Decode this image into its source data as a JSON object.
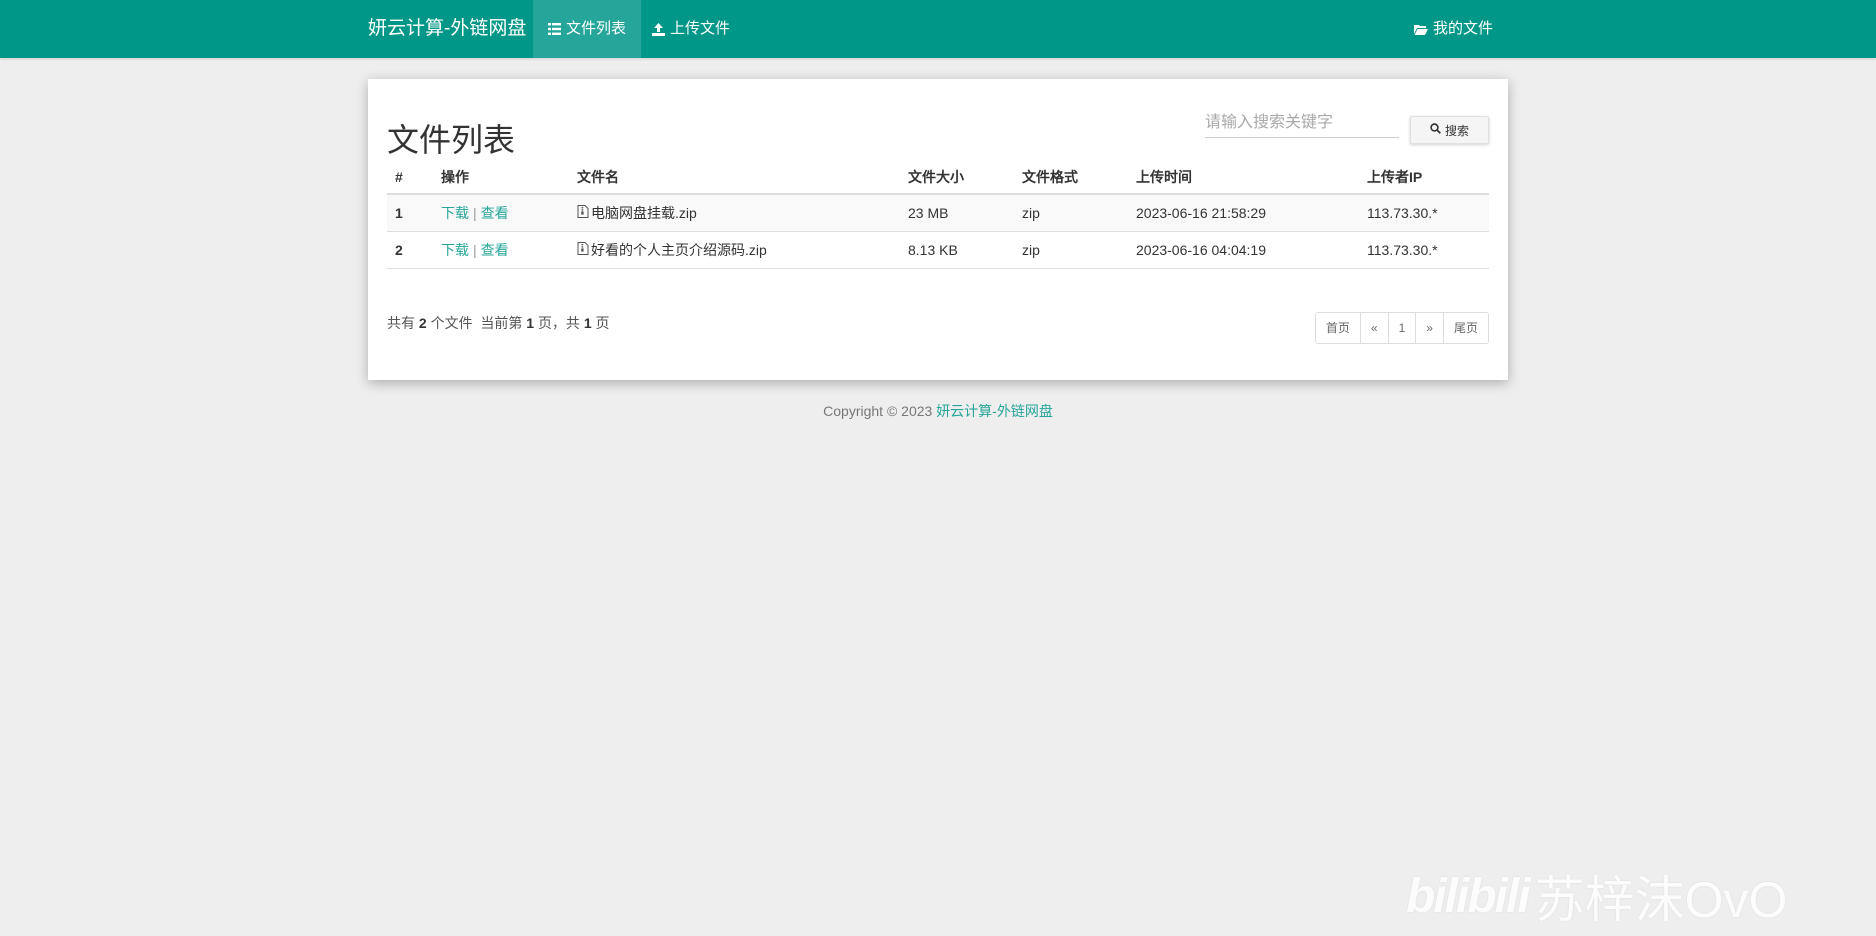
{
  "navbar": {
    "brand": "妍云计算-外链网盘",
    "items": [
      {
        "label": "文件列表",
        "icon": "list-icon",
        "active": true
      },
      {
        "label": "上传文件",
        "icon": "upload-icon",
        "active": false
      }
    ],
    "right_item": {
      "label": "我的文件",
      "icon": "folder-open-icon"
    },
    "color": "#009688"
  },
  "main": {
    "title": "文件列表",
    "search": {
      "placeholder": "请输入搜索关键字",
      "button_label": "搜索"
    },
    "table": {
      "headers": [
        "#",
        "操作",
        "文件名",
        "文件大小",
        "文件格式",
        "上传时间",
        "上传者IP"
      ],
      "rows": [
        {
          "index": "1",
          "download": "下载",
          "sep": "|",
          "view": "查看",
          "filename": "电脑网盘挂载.zip",
          "size": "23 MB",
          "format": "zip",
          "time": "2023-06-16 21:58:29",
          "ip": "113.73.30.*"
        },
        {
          "index": "2",
          "download": "下载",
          "sep": "|",
          "view": "查看",
          "filename": "好看的个人主页介绍源码.zip",
          "size": "8.13 KB",
          "format": "zip",
          "time": "2023-06-16 04:04:19",
          "ip": "113.73.30.*"
        }
      ]
    },
    "summary": {
      "p1": "共有",
      "count": "2",
      "p2": "个文件  当前第",
      "current": "1",
      "p3": "页，共",
      "total": "1",
      "p4": "页"
    },
    "pagination": [
      "首页",
      "«",
      "1",
      "»",
      "尾页"
    ]
  },
  "footer": {
    "copyright": "Copyright © 2023 ",
    "link": "妍云计算-外链网盘"
  },
  "watermark": {
    "logo": "bilibili",
    "text": "苏梓沫OvO"
  }
}
